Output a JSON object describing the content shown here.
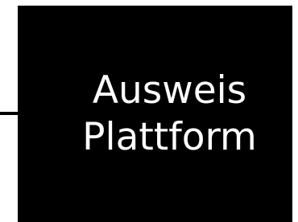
{
  "node": {
    "line1": "Ausweis",
    "line2": "Plattform"
  },
  "colors": {
    "background": "#ffffff",
    "node_fill": "#000000",
    "node_text": "#ffffff",
    "connector": "#000000"
  }
}
